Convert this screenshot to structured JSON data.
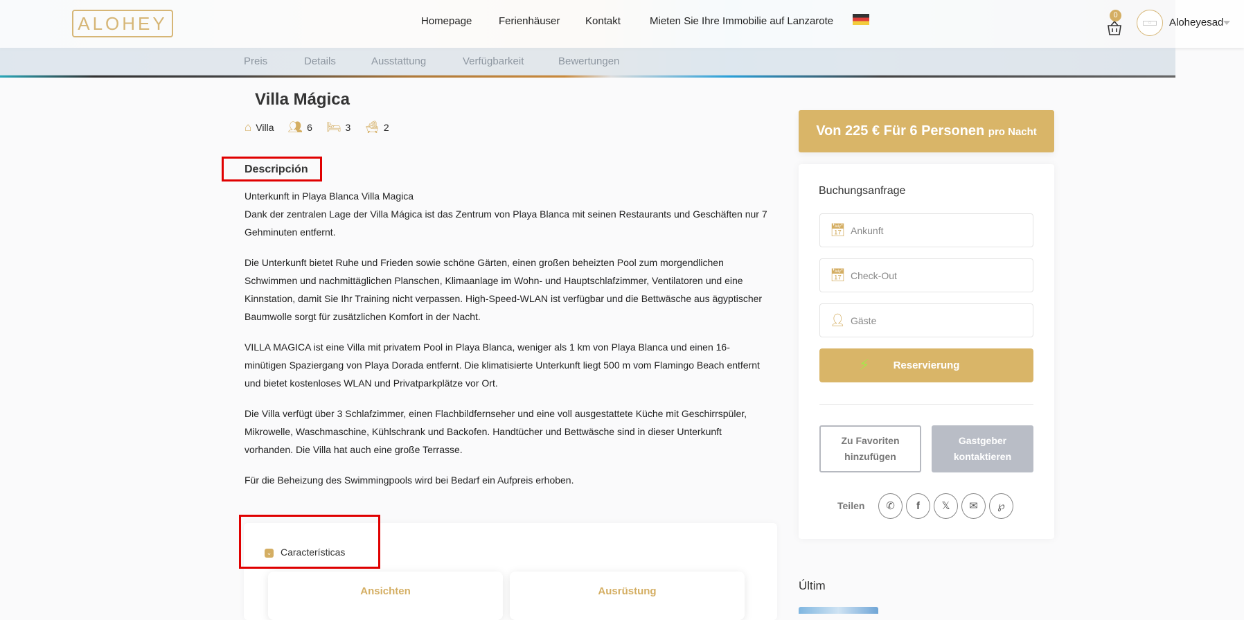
{
  "header": {
    "logo": "ALOHEY",
    "nav": [
      "Homepage",
      "Ferienhäuser",
      "Kontakt",
      "Mieten Sie Ihre Immobilie auf Lanzarote"
    ],
    "language": "de",
    "cart_count": "0",
    "user": "Aloheyesad"
  },
  "subnav": [
    "Preis",
    "Details",
    "Ausstattung",
    "Verfügbarkeit",
    "Bewertungen"
  ],
  "property": {
    "title": "Villa Mágica",
    "type": "Villa",
    "guests": "6",
    "bedrooms": "3",
    "bathrooms": "2"
  },
  "description": {
    "heading": "Descripción",
    "paragraphs": [
      "Unterkunft in Playa Blanca Villa Magica\nDank der zentralen Lage der Villa Mágica ist das Zentrum von Playa Blanca mit seinen Restaurants und Geschäften nur 7 Gehminuten entfernt.",
      "Die Unterkunft bietet Ruhe und Frieden sowie schöne Gärten, einen großen beheizten Pool zum morgendlichen Schwimmen und nachmittäglichen Planschen, Klimaanlage im Wohn- und Hauptschlafzimmer, Ventilatoren und eine Kinnstation, damit Sie Ihr Training nicht verpassen. High-Speed-WLAN ist verfügbar und die Bettwäsche aus ägyptischer Baumwolle sorgt für zusätzlichen Komfort in der Nacht.",
      "VILLA MAGICA ist eine Villa mit privatem Pool in Playa Blanca, weniger als 1 km von Playa Blanca und einen 16-minütigen Spaziergang von Playa Dorada entfernt. Die klimatisierte Unterkunft liegt 500 m vom Flamingo Beach entfernt und bietet kostenloses WLAN und Privatparkplätze vor Ort.",
      "Die Villa verfügt über 3 Schlafzimmer, einen Flachbildfernseher und eine voll ausgestattete Küche mit Geschirrspüler, Mikrowelle, Waschmaschine, Kühlschrank und Backofen. Handtücher und Bettwäsche sind in dieser Unterkunft vorhanden. Die Villa hat auch eine große Terrasse.",
      "Für die Beheizung des Swimmingpools wird bei Bedarf ein Aufpreis erhoben."
    ]
  },
  "features": {
    "heading": "Características",
    "cards": [
      "Ansichten",
      "Ausrüstung"
    ]
  },
  "sidebar": {
    "price_main": "Von 225 € Für 6 Personen",
    "price_suffix": "pro Nacht",
    "booking_title": "Buchungsanfrage",
    "arrival_placeholder": "Ankunft",
    "checkout_placeholder": "Check-Out",
    "guests_placeholder": "Gäste",
    "reserve_label": "Reservierung",
    "favorite_label": "Zu Favoriten hinzufügen",
    "contact_label": "Gastgeber kontaktieren",
    "share_label": "Teilen",
    "latest_heading": "Últim"
  },
  "colors": {
    "accent": "#d9b568",
    "disabled": "#b9bdc6",
    "highlight": "#e00000"
  }
}
